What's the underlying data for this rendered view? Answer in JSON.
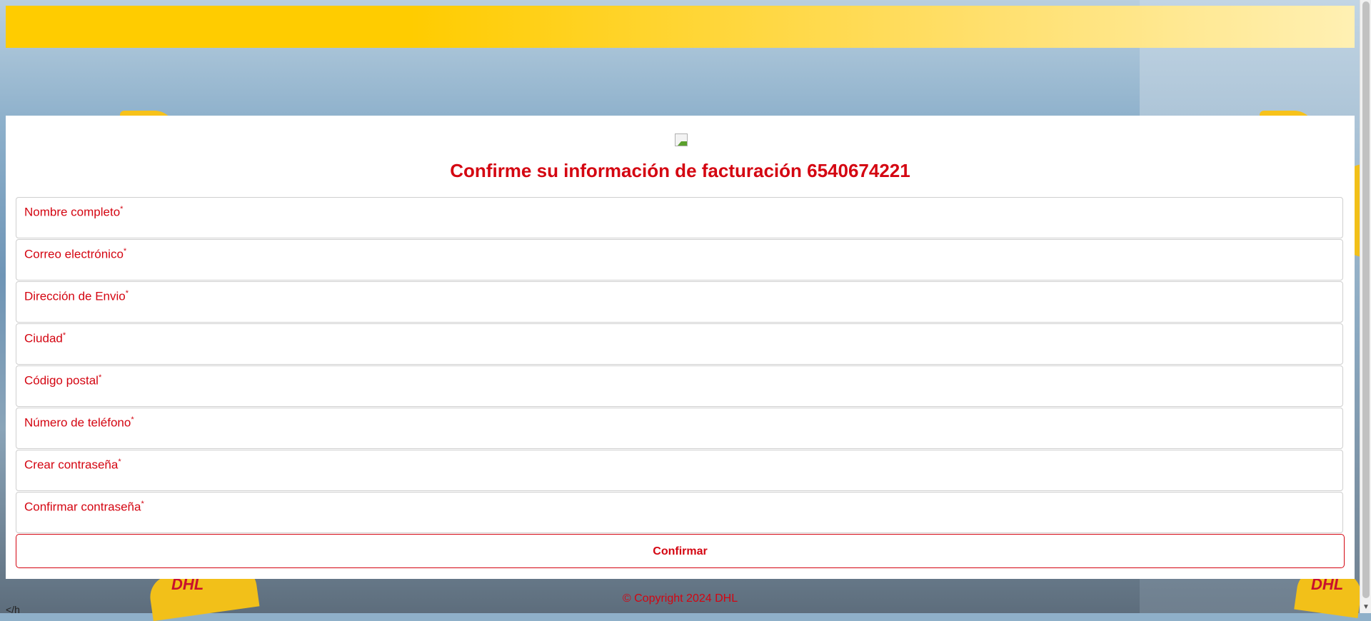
{
  "title": "Confirme su información de facturación 6540674221",
  "fields": [
    {
      "label": "Nombre completo",
      "required_mark": "*"
    },
    {
      "label": "Correo electrónico",
      "required_mark": "*"
    },
    {
      "label": "Dirección de Envio",
      "required_mark": "*"
    },
    {
      "label": "Ciudad",
      "required_mark": "*"
    },
    {
      "label": "Código postal",
      "required_mark": "*"
    },
    {
      "label": "Número de teléfono",
      "required_mark": "*"
    },
    {
      "label": "Crear contraseña",
      "required_mark": "*"
    },
    {
      "label": "Confirmar contraseña",
      "required_mark": "*"
    }
  ],
  "submit_label": "Confirmar",
  "footer": "© Copyright 2024 DHL",
  "stray_text": "</h",
  "colors": {
    "accent": "#d40511",
    "header_yellow": "#ffcc00",
    "card": "#ffffff"
  },
  "icons": {
    "broken_image": "broken-image-icon"
  }
}
